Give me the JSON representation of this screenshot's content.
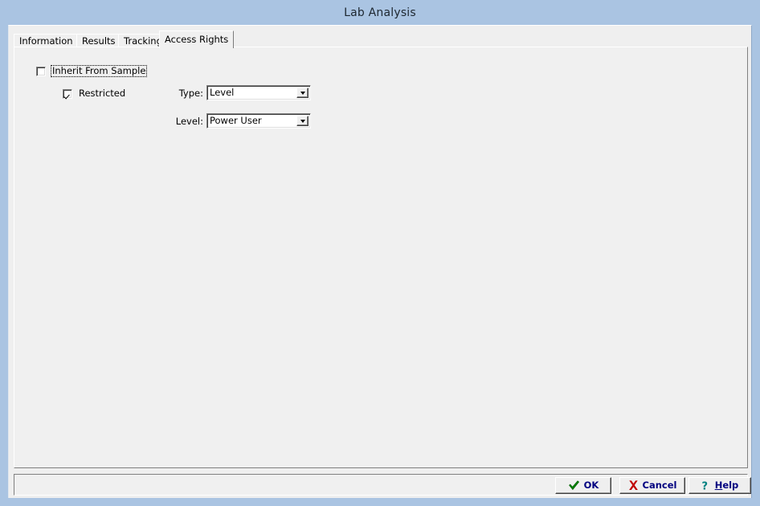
{
  "window": {
    "title": "Lab Analysis"
  },
  "tabs": [
    {
      "label": "Information",
      "active": false
    },
    {
      "label": "Results",
      "active": false
    },
    {
      "label": "Tracking",
      "active": false
    },
    {
      "label": "Access Rights",
      "active": true
    }
  ],
  "form": {
    "inherit_from_sample": {
      "label": "Inherit From Sample",
      "checked": false,
      "focused": true
    },
    "restricted": {
      "label": "Restricted",
      "checked": true
    },
    "type_field": {
      "label": "Type:",
      "value": "Level",
      "icon": "chevron-down-icon"
    },
    "level_field": {
      "label": "Level:",
      "value": "Power User",
      "icon": "chevron-down-icon"
    }
  },
  "buttons": {
    "ok": {
      "label": "OK",
      "icon": "check-icon",
      "icon_color": "#008000"
    },
    "cancel": {
      "label": "Cancel",
      "icon": "x-icon",
      "icon_color": "#c00000"
    },
    "help": {
      "label_before": "",
      "accel": "H",
      "label_after": "elp",
      "icon": "question-mark-icon",
      "icon_color": "#008080"
    }
  },
  "colors": {
    "titlebar": "#aac4e2",
    "client": "#efefef",
    "button_text": "#000080"
  }
}
